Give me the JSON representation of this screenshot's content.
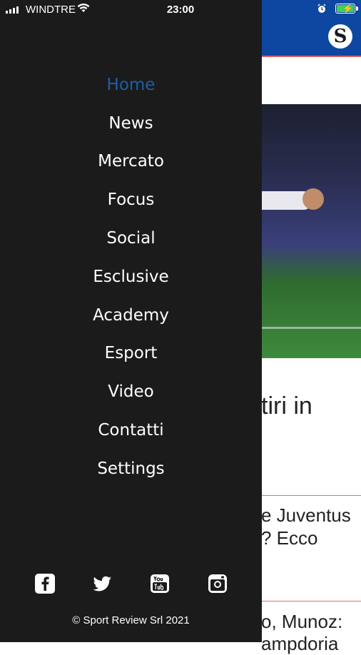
{
  "status_bar": {
    "carrier": "WINDTRE",
    "time": "23:00"
  },
  "background_page": {
    "title_fragment": "tiri in",
    "headline_2_line1": "e Juventus",
    "headline_2_line2": "? Ecco",
    "headline_3_line1": "o, Munoz:",
    "headline_3_line2": "ampdoria"
  },
  "drawer": {
    "active_item": "Home",
    "menu_items": [
      {
        "label": "Home"
      },
      {
        "label": "News"
      },
      {
        "label": "Mercato"
      },
      {
        "label": "Focus"
      },
      {
        "label": "Social"
      },
      {
        "label": "Esclusive"
      },
      {
        "label": "Academy"
      },
      {
        "label": "Esport"
      },
      {
        "label": "Video"
      },
      {
        "label": "Contatti"
      },
      {
        "label": "Settings"
      }
    ],
    "social_icons": [
      "facebook-icon",
      "twitter-icon",
      "youtube-icon",
      "instagram-icon"
    ],
    "copyright": "© Sport Review Srl 2021"
  },
  "colors": {
    "drawer_background": "#1b1b1c",
    "active_item": "#1a5fa8",
    "header_blue": "#0d47a1",
    "battery_green": "#41d050"
  }
}
